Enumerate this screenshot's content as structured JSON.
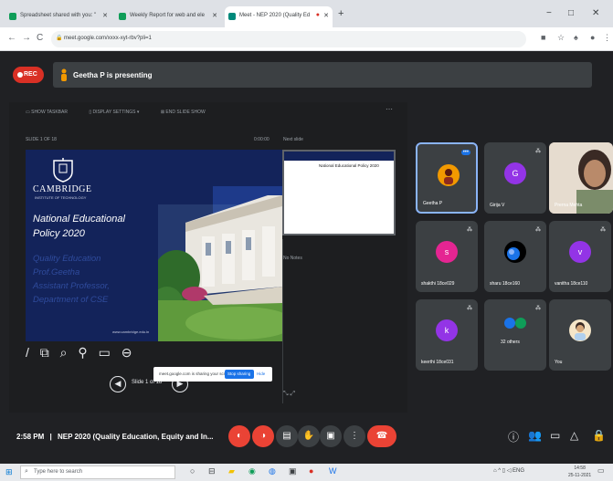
{
  "browser": {
    "tabs": [
      {
        "title": "Spreadsheet shared with you: \"",
        "favicon_color": "#0f9d58",
        "active": false
      },
      {
        "title": "Weekly Report for web and ele",
        "favicon_color": "#0f9d58",
        "active": false
      },
      {
        "title": "Meet - NEP 2020 (Quality Ed",
        "favicon_color": "#00897b",
        "active": true
      }
    ],
    "new_tab": "+",
    "window_controls": [
      "−",
      "□",
      "✕"
    ],
    "address": "meet.google.com/xxxx-xyt-rbv?pli=1",
    "nav": [
      "←",
      "→",
      "C"
    ]
  },
  "banner": {
    "rec_label": "REC",
    "presenting_text": "Geetha P is presenting"
  },
  "presentation": {
    "toolbar": [
      "▭ SHOW TASKBAR",
      "▯ DISPLAY SETTINGS ▾",
      "⊠ END SLIDE SHOW"
    ],
    "slide_info": "SLIDE 1 OF 18",
    "slide_time": "0:00:00",
    "next_label": "Next slide",
    "notes_label": "No Notes",
    "slide": {
      "university": "CAMBRIDGE",
      "university_sub": "INSTITUTE OF TECHNOLOGY",
      "title_lines": [
        "National Educational",
        "Policy 2020"
      ],
      "body_lines": [
        "Quality Education",
        "Prof.Geetha",
        "Assistant Professor,",
        "Department of CSE"
      ],
      "url": "www.cambridge.edu.in"
    },
    "next_slide_title": "National Educational Policy 2020",
    "slide_counter": "Slide 1 of 18",
    "share_text": "meet.google.com is sharing your screen.",
    "stop_label": "Stop sharing",
    "hide_label": "Hide"
  },
  "participants": [
    {
      "name": "Geetha P",
      "initial": "",
      "color": "#8d2a1e",
      "speaking": true
    },
    {
      "name": "Girija V",
      "initial": "G",
      "color": "#9334e6"
    },
    {
      "name": "Prerna Mehta",
      "initial": "",
      "color": "#c9a98a",
      "photo": true
    },
    {
      "name": "shakthi 18ce029",
      "initial": "s",
      "color": "#e52592"
    },
    {
      "name": "sharu 18ce160",
      "initial": "",
      "color": "#1a73e8",
      "planet": true
    },
    {
      "name": "vanitha 18ce110",
      "initial": "v",
      "color": "#9334e6"
    },
    {
      "name": "keerthi 18ce031",
      "initial": "k",
      "color": "#9334e6"
    },
    {
      "name": "32 others",
      "initial": "",
      "color": "#3c4043",
      "others": true
    },
    {
      "name": "You",
      "initial": "",
      "color": "#e8c49b",
      "you": true
    }
  ],
  "bottombar": {
    "time": "2:58 PM",
    "meeting_title": "NEP 2020 (Quality Education, Equity and In...",
    "separator": "|"
  },
  "taskbar": {
    "search_placeholder": "Type here to search",
    "time": "14:58",
    "date": "25-11-2021",
    "tray_text": "ENG"
  }
}
